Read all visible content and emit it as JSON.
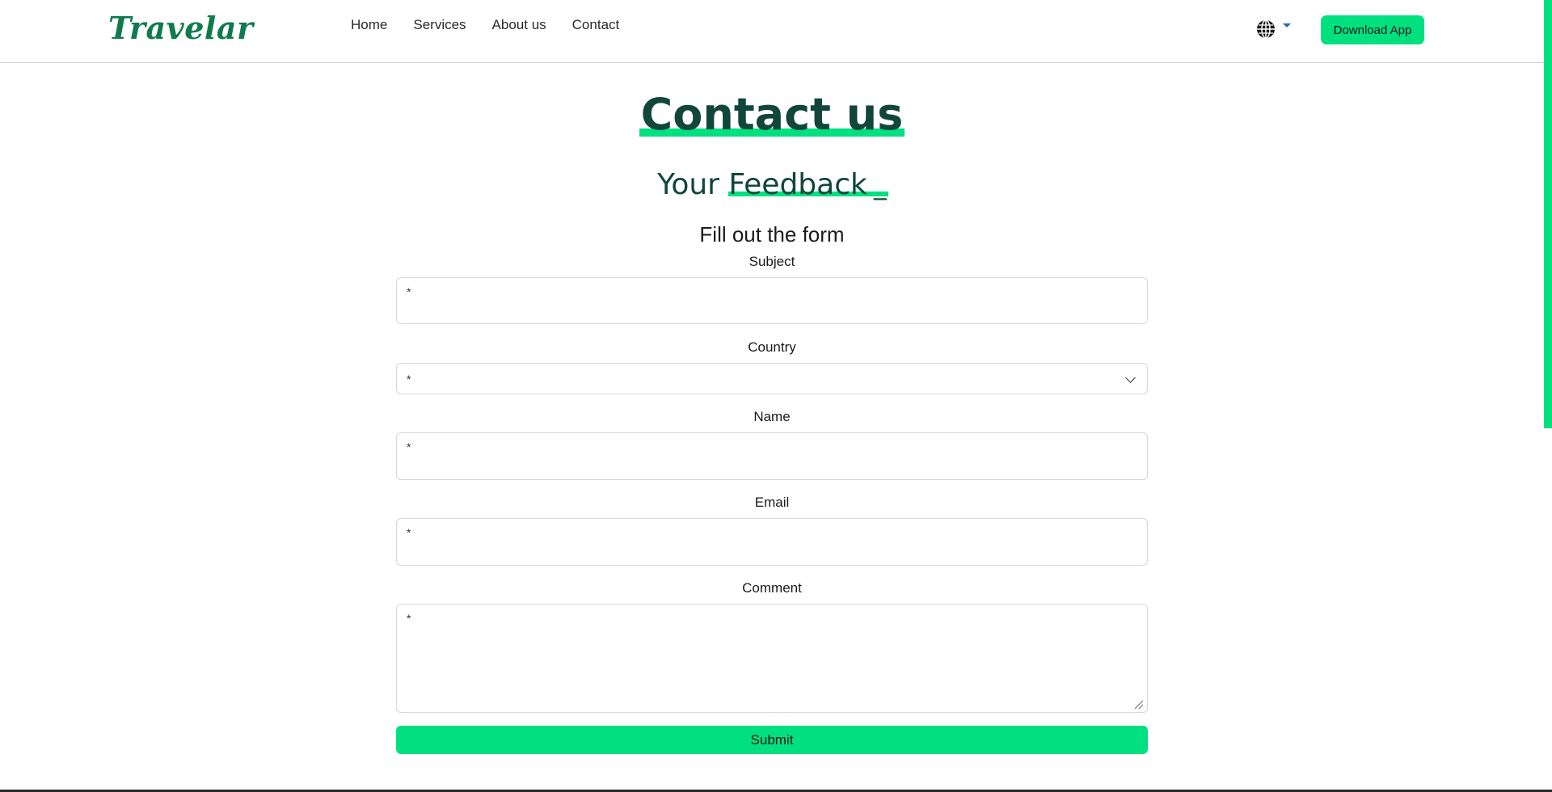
{
  "navbar": {
    "logo": "Travelar",
    "links": [
      "Home",
      "Services",
      "About us",
      "Contact"
    ],
    "language_icon": "globe-icon",
    "download_label": "Download App"
  },
  "colors": {
    "accent": "#00e07f",
    "heading": "#12463a",
    "logo": "#0f7a4f"
  },
  "header": {
    "title": "Contact us",
    "subtitle_prefix": "Your",
    "subtitle_highlight": "Feedback",
    "subtitle_cursor": "_"
  },
  "form": {
    "heading": "Fill out the form",
    "fields": {
      "subject": {
        "label": "Subject",
        "placeholder": "*"
      },
      "country": {
        "label": "Country",
        "value": "*"
      },
      "name": {
        "label": "Name",
        "placeholder": "*"
      },
      "email": {
        "label": "Email",
        "placeholder": "*"
      },
      "comment": {
        "label": "Comment",
        "placeholder": "*"
      }
    },
    "submit_label": "Submit"
  }
}
